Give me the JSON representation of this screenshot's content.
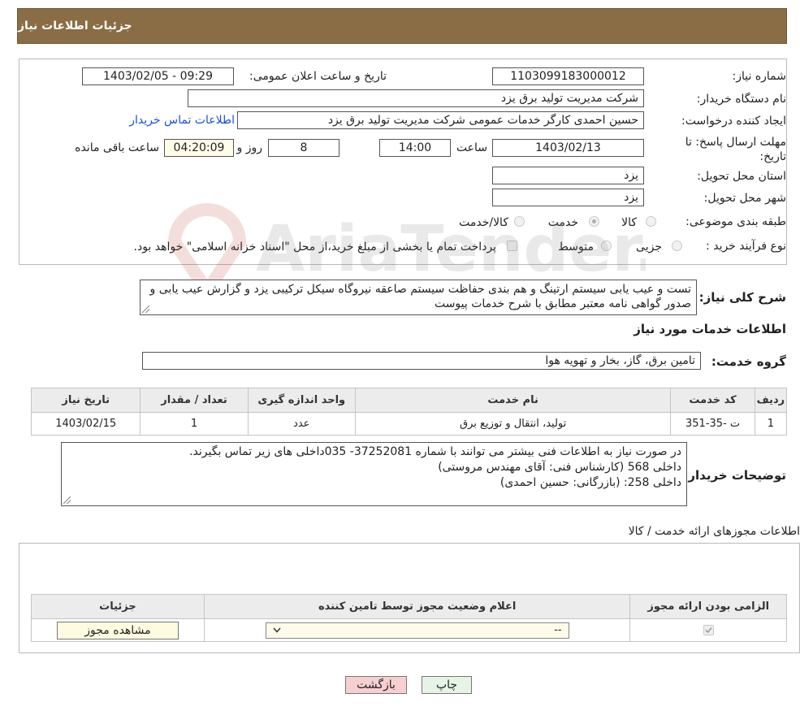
{
  "header": {
    "title": "جزئیات اطلاعات نیاز"
  },
  "info": {
    "need_number_label": "شماره نیاز:",
    "need_number": "1103099183000012",
    "announce_label": "تاریخ و ساعت اعلان عمومی:",
    "announce_value": "1403/02/05 - 09:29",
    "buyer_org_label": "نام دستگاه خریدار:",
    "buyer_org": "شرکت مدیریت تولید برق یزد",
    "creator_label": "ایجاد کننده درخواست:",
    "creator": "حسین احمدی کارگر خدمات عمومی شرکت مدیریت تولید برق یزد",
    "contact_link": "اطلاعات تماس خریدار",
    "deadline_label": "مهلت ارسال پاسخ: تا تاریخ:",
    "deadline_date": "1403/02/13",
    "time_label": "ساعت",
    "deadline_time": "14:00",
    "days_value": "8",
    "days_label": "روز و",
    "remaining_time": "04:20:09",
    "remaining_label": "ساعت باقی مانده",
    "province_label": "استان محل تحویل:",
    "province": "یزد",
    "city_label": "شهر محل تحویل:",
    "city": "یزد",
    "category_label": "طبقه بندی موضوعی:",
    "category_options": [
      "کالا",
      "خدمت",
      "کالا/خدمت"
    ],
    "category_selected": "خدمت",
    "process_label": "نوع فرآیند خرید :",
    "process_options": [
      "جزیی",
      "متوسط"
    ],
    "payment_note": "پرداخت تمام یا بخشی از مبلغ خرید،از محل \"اسناد خزانه اسلامی\" خواهد بود."
  },
  "summary": {
    "label": "شرح کلی نیاز:",
    "text": "تست  و عیب یابی  سیستم ارتینگ  و هم بندی حفاظت  سیستم صاعقه نیروگاه سیکل ترکیبی یزد و گزارش عیب یابی و  صدور گواهی نامه معتبر مطابق با شرح خدمات پیوست"
  },
  "services": {
    "section_title": "اطلاعات خدمات مورد نیاز",
    "group_label": "گروه خدمت:",
    "group_value": "تامین برق، گاز، بخار و تهویه هوا",
    "columns": [
      "ردیف",
      "کد خدمت",
      "نام خدمت",
      "واحد اندازه گیری",
      "تعداد / مقدار",
      "تاریخ نیاز"
    ],
    "rows": [
      {
        "row": "1",
        "code": "ت -35-351",
        "name": "تولید، انتقال و توزیع برق",
        "unit": "عدد",
        "qty": "1",
        "date": "1403/02/15"
      }
    ]
  },
  "buyer_notes": {
    "label": "توضیحات خریدار:",
    "lines": [
      "در صورت نیاز به اطلاعات فنی بیشتر می توانند با شماره 37252081- 035داخلی های زیر تماس بگیرند.",
      "داخلی 568 (کارشناس فنی: آقای مهندس مروستی)",
      "داخلی 258: (بازرگانی: حسین احمدی)"
    ]
  },
  "permits": {
    "section_title": "اطلاعات مجوزهای ارائه خدمت / کالا",
    "columns": [
      "الزامی بودن ارائه مجوز",
      "اعلام وضعیت مجوز توسط تامین کننده",
      "جزئیات"
    ],
    "select_value": "--",
    "view_button": "مشاهده مجوز"
  },
  "footer": {
    "back_button": "بازگشت",
    "print_button": "چاپ"
  },
  "watermark": {
    "text": "AriaTender.neT"
  },
  "colors": {
    "header": "#8a6d45",
    "back_button": "#f6d0d0",
    "print_button": "#e6f4e6",
    "view_button": "#fffbe0",
    "link": "#1a4fd6"
  }
}
